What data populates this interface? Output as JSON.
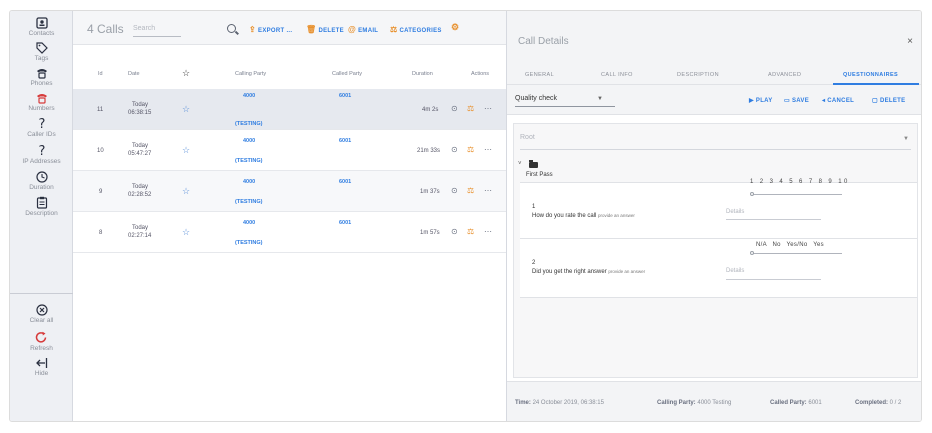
{
  "sidebar": {
    "items": [
      {
        "label": "Contacts",
        "icon": "contacts-icon"
      },
      {
        "label": "Tags",
        "icon": "tag-icon"
      },
      {
        "label": "Phones",
        "icon": "phone-icon"
      },
      {
        "label": "Numbers",
        "icon": "numbers-icon"
      },
      {
        "label": "Caller IDs",
        "icon": "question-icon"
      },
      {
        "label": "IP Addresses",
        "icon": "question-icon"
      },
      {
        "label": "Duration",
        "icon": "clock-icon"
      },
      {
        "label": "Description",
        "icon": "clipboard-icon"
      },
      {
        "label": "Clear all",
        "icon": "clear-icon"
      },
      {
        "label": "Refresh",
        "icon": "refresh-icon"
      },
      {
        "label": "Hide",
        "icon": "hide-icon"
      }
    ]
  },
  "calls": {
    "title": "4 Calls",
    "search_placeholder": "Search",
    "toolbar": {
      "export": "EXPORT ...",
      "delete": "DELETE",
      "email": "EMAIL",
      "categories": "CATEGORIES"
    },
    "columns": [
      "Id",
      "Date",
      "Calling Party",
      "Called Party",
      "Duration",
      "Actions"
    ],
    "rows": [
      {
        "id": "11",
        "date": "Today",
        "time": "06:38:15",
        "calling": "4000",
        "calling_name": "(TESTING)",
        "called": "6001",
        "duration": "4m 2s"
      },
      {
        "id": "10",
        "date": "Today",
        "time": "05:47:27",
        "calling": "4000",
        "calling_name": "(TESTING)",
        "called": "6001",
        "duration": "21m 33s"
      },
      {
        "id": "9",
        "date": "Today",
        "time": "02:28:52",
        "calling": "4000",
        "calling_name": "(TESTING)",
        "called": "6001",
        "duration": "1m 37s"
      },
      {
        "id": "8",
        "date": "Today",
        "time": "02:27:14",
        "calling": "4000",
        "calling_name": "(TESTING)",
        "called": "6001",
        "duration": "1m 57s"
      }
    ]
  },
  "details": {
    "title": "Call Details",
    "close": "×",
    "tabs": [
      "GENERAL",
      "CALL INFO",
      "DESCRIPTION",
      "ADVANCED",
      "QUESTIONNAIRES"
    ],
    "questionnaire": "Quality check",
    "actions": {
      "play": "PLAY",
      "save": "SAVE",
      "cancel": "CANCEL",
      "delete": "DELETE"
    },
    "root_placeholder": "Root",
    "folder": "First Pass",
    "questions": [
      {
        "num": "1",
        "text": "How do you rate the call",
        "hint": "provide an answer",
        "scale": "1 2 3 4 5 6 7 8 9 10",
        "details": "Details"
      },
      {
        "num": "2",
        "text": "Did you get the right answer",
        "hint": "provide an answer",
        "scale": "N/A   No   Yes/No   Yes",
        "details": "Details"
      }
    ],
    "footer": {
      "time_label": "Time:",
      "time": "24 October 2019, 06:38:15",
      "calling_label": "Calling Party:",
      "calling": "4000 Testing",
      "called_label": "Called Party:",
      "called": "6001",
      "completed_label": "Completed:",
      "completed": "0 / 2"
    }
  },
  "colors": {
    "accent": "#2f7de1",
    "orange": "#e8912e"
  }
}
